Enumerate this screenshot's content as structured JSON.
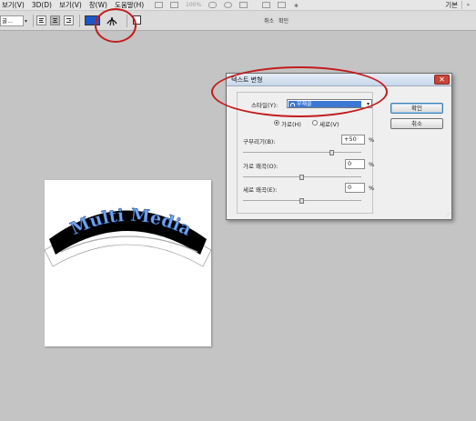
{
  "menubar": {
    "items": [
      "보기(V)",
      "3D(D)",
      "보기(V)",
      "창(W)",
      "도움말(H)"
    ],
    "zoom": "100%",
    "workspace": "기본"
  },
  "options": {
    "font_value": "굴...",
    "text_color": "#1c56c6",
    "right_label_1": "취소",
    "right_label_2": "확인"
  },
  "dialog": {
    "title": "텍스트 변형",
    "style_label": "스타일(Y):",
    "style_value": "부채꼴",
    "horizontal_label": "가로(H)",
    "vertical_label": "세로(V)",
    "bend_label": "구부리기(B):",
    "bend_value": "+50",
    "hdist_label": "가로 왜곡(O):",
    "hdist_value": "0",
    "vdist_label": "세로 왜곡(E):",
    "vdist_value": "0",
    "percent": "%",
    "ok_label": "확인",
    "cancel_label": "취소",
    "bend_level": 50,
    "hdist_level": 0,
    "vdist_level": 0
  },
  "canvas": {
    "warp_text": "Multi Media",
    "text_fill": "#6fa3f2",
    "band_fill": "#000000"
  }
}
